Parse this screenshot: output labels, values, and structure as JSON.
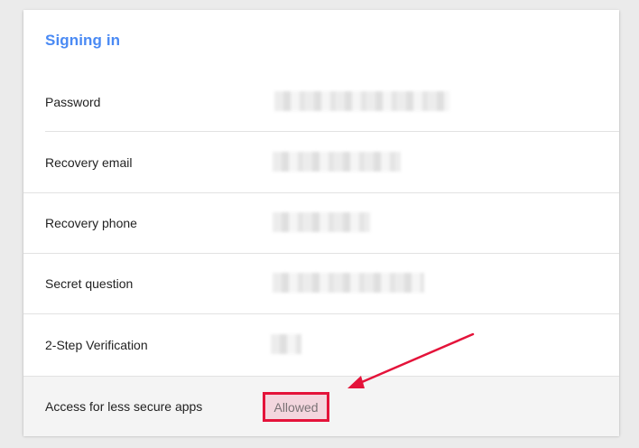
{
  "section": {
    "title": "Signing in"
  },
  "rows": [
    {
      "label": "Password"
    },
    {
      "label": "Recovery email"
    },
    {
      "label": "Recovery phone"
    },
    {
      "label": "Secret question"
    },
    {
      "label": "2-Step Verification"
    }
  ],
  "less_secure_apps": {
    "label": "Access for less secure apps",
    "status": "Allowed"
  },
  "colors": {
    "title": "#4a8af4",
    "highlight_border": "#e4133a",
    "highlight_fill": "#f3d6de",
    "annotation_arrow": "#e4133a"
  }
}
